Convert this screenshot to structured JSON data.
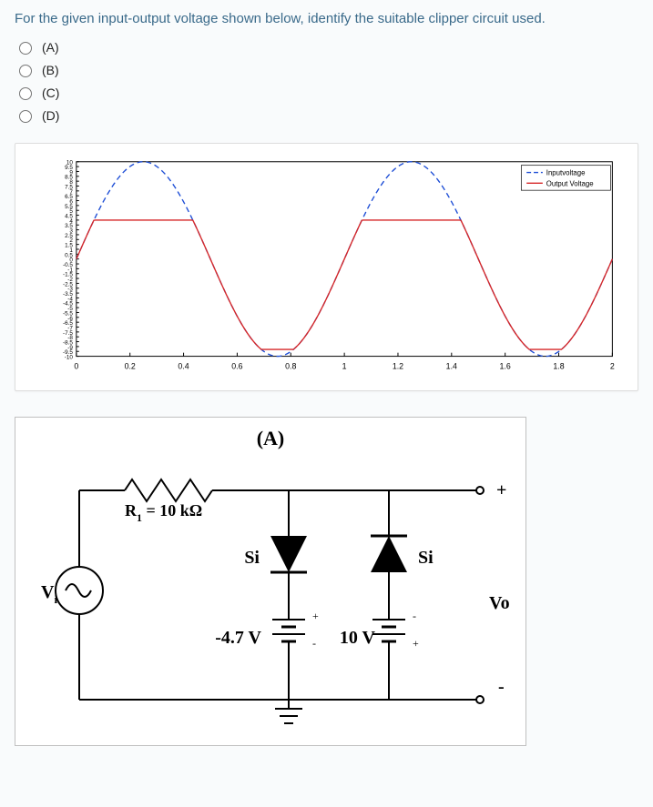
{
  "question": "For the given input-output voltage shown below, identify the suitable clipper circuit used.",
  "options": [
    {
      "label": "(A)"
    },
    {
      "label": "(B)"
    },
    {
      "label": "(C)"
    },
    {
      "label": "(D)"
    }
  ],
  "chart_data": {
    "type": "line",
    "title": "",
    "xlabel": "",
    "ylabel": "",
    "xlim": [
      0,
      2
    ],
    "ylim": [
      -10,
      10
    ],
    "x_ticks": [
      0,
      0.2,
      0.4,
      0.6,
      0.8,
      1,
      1.2,
      1.4,
      1.6,
      1.8,
      2
    ],
    "y_ticks": [
      10,
      9.5,
      9,
      8.5,
      8,
      7.5,
      7,
      6.5,
      6,
      5.5,
      5,
      4.5,
      4,
      3.5,
      3,
      2.5,
      2,
      1.5,
      1,
      0.5,
      0,
      -0.5,
      -1,
      -1.5,
      -2,
      -2.5,
      -3,
      -3.5,
      -4,
      -4.5,
      -5,
      -5.5,
      -6,
      -6.5,
      -7,
      -7.5,
      -8,
      -8.5,
      -9,
      -9.5,
      -10
    ],
    "legend": [
      "Inputvoltage",
      "Output Voltage"
    ],
    "series": [
      {
        "name": "Inputvoltage",
        "color": "#1f4fd6",
        "note": "10·sin(2π·x), dashed",
        "amplitude": 10,
        "periods": 2
      },
      {
        "name": "Output Voltage",
        "color": "#d62728",
        "note": "Input clipped to range approx [-9.3, 4] (negative slightly clipped near -9.3, positive clipped at ~4)",
        "clip_high": 4,
        "clip_low": -9.3
      }
    ]
  },
  "circuit": {
    "title": "(A)",
    "source_label": "V",
    "source_sub": "i",
    "resistor_label": "R",
    "resistor_sub": "1",
    "resistor_value": " = 10 kΩ",
    "diode1_label": "Si",
    "diode2_label": "Si",
    "battery1_label": "-4.7 V",
    "battery2_label": "10 V",
    "out_label": "Vo",
    "plus": "+",
    "minus": "-",
    "batt_plus": "+",
    "batt_minus": "-"
  }
}
